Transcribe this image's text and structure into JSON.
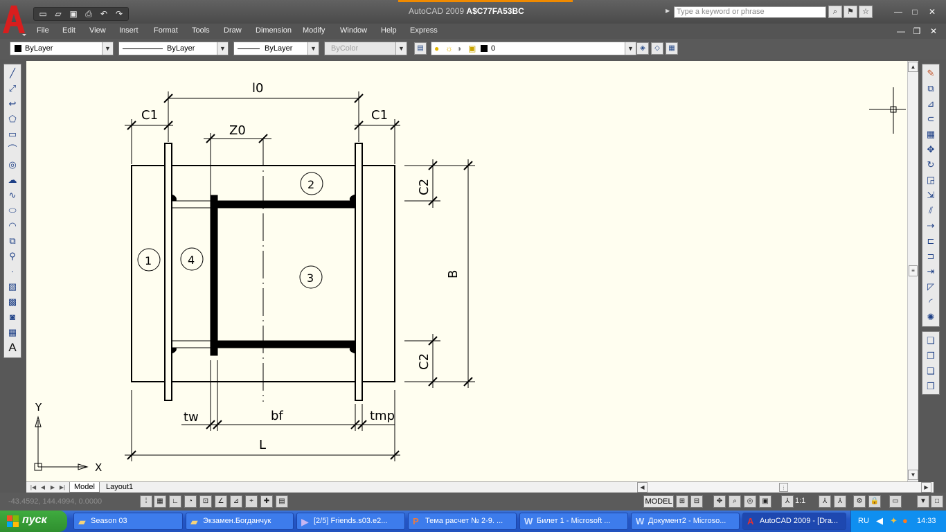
{
  "window": {
    "app_name": "AutoCAD 2009",
    "document_code": "A$C77FA53BC",
    "search_placeholder": "Type a keyword or phrase"
  },
  "menu": [
    "File",
    "Edit",
    "View",
    "Insert",
    "Format",
    "Tools",
    "Draw",
    "Dimension",
    "Modify",
    "Window",
    "Help",
    "Express"
  ],
  "properties": {
    "color": "ByLayer",
    "linetype": "ByLayer",
    "lineweight": "ByLayer",
    "plotstyle": "ByColor",
    "layer": "0"
  },
  "drawing": {
    "labels": {
      "l0": "l0",
      "c1_left": "C1",
      "c1_right": "C1",
      "z0": "Z0",
      "c2_top": "C2",
      "c2_bottom": "C2",
      "b": "B",
      "tw": "tw",
      "bf": "bf",
      "tmp": "tmp",
      "l": "L"
    },
    "parts": [
      "1",
      "2",
      "3",
      "4"
    ],
    "ucs_x": "X",
    "ucs_y": "Y"
  },
  "tabs": [
    "Model",
    "Layout1"
  ],
  "status": {
    "coords": "-43.4592, 144.4994, 0.0000",
    "model": "MODEL",
    "scale": "1:1"
  },
  "taskbar": {
    "start": "пуск",
    "items": [
      "Season 03",
      "Экзамен.Богданчук",
      "[2/5] Friends.s03.e2...",
      "Тема расчет № 2-9. ...",
      "Билет 1 - Microsoft ...",
      "Документ2 - Microso...",
      "AutoCAD 2009 - [Dra..."
    ],
    "lang": "RU",
    "time": "14:33"
  }
}
